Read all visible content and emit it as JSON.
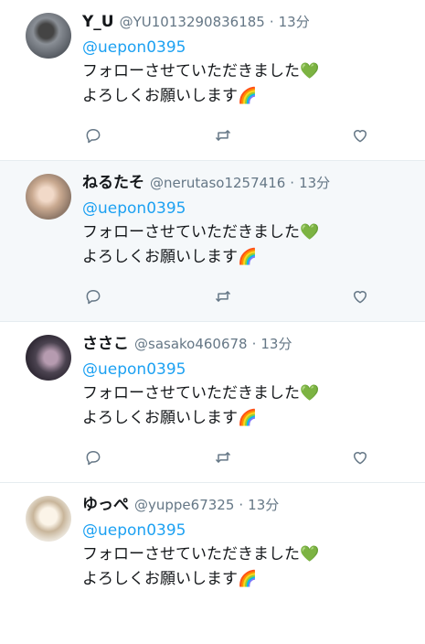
{
  "tweets": [
    {
      "name": "Y_U",
      "handle": "@YU1013290836185",
      "sep": "·",
      "time": "13分",
      "mention": "@uepon0395",
      "line1": "フォローさせていただきました",
      "line1_emoji": "💚",
      "line2": "よろしくお願いします",
      "line2_emoji": "🌈",
      "highlighted": false
    },
    {
      "name": "ねるたそ",
      "handle": "@nerutaso1257416",
      "sep": "·",
      "time": "13分",
      "mention": "@uepon0395",
      "line1": "フォローさせていただきました",
      "line1_emoji": "💚",
      "line2": "よろしくお願いします",
      "line2_emoji": "🌈",
      "highlighted": true
    },
    {
      "name": "ささこ",
      "handle": "@sasako460678",
      "sep": "·",
      "time": "13分",
      "mention": "@uepon0395",
      "line1": "フォローさせていただきました",
      "line1_emoji": "💚",
      "line2": "よろしくお願いします",
      "line2_emoji": "🌈",
      "highlighted": false
    },
    {
      "name": "ゆっぺ",
      "handle": "@yuppe67325",
      "sep": "·",
      "time": "13分",
      "mention": "@uepon0395",
      "line1": "フォローさせていただきました",
      "line1_emoji": "💚",
      "line2": "よろしくお願いします",
      "line2_emoji": "🌈",
      "highlighted": false
    }
  ],
  "icons": {
    "reply": "reply-icon",
    "retweet": "retweet-icon",
    "like": "like-icon"
  },
  "colors": {
    "mention": "#1da1f2",
    "secondary_text": "#657786",
    "highlight_bg": "#f5f8fa"
  }
}
